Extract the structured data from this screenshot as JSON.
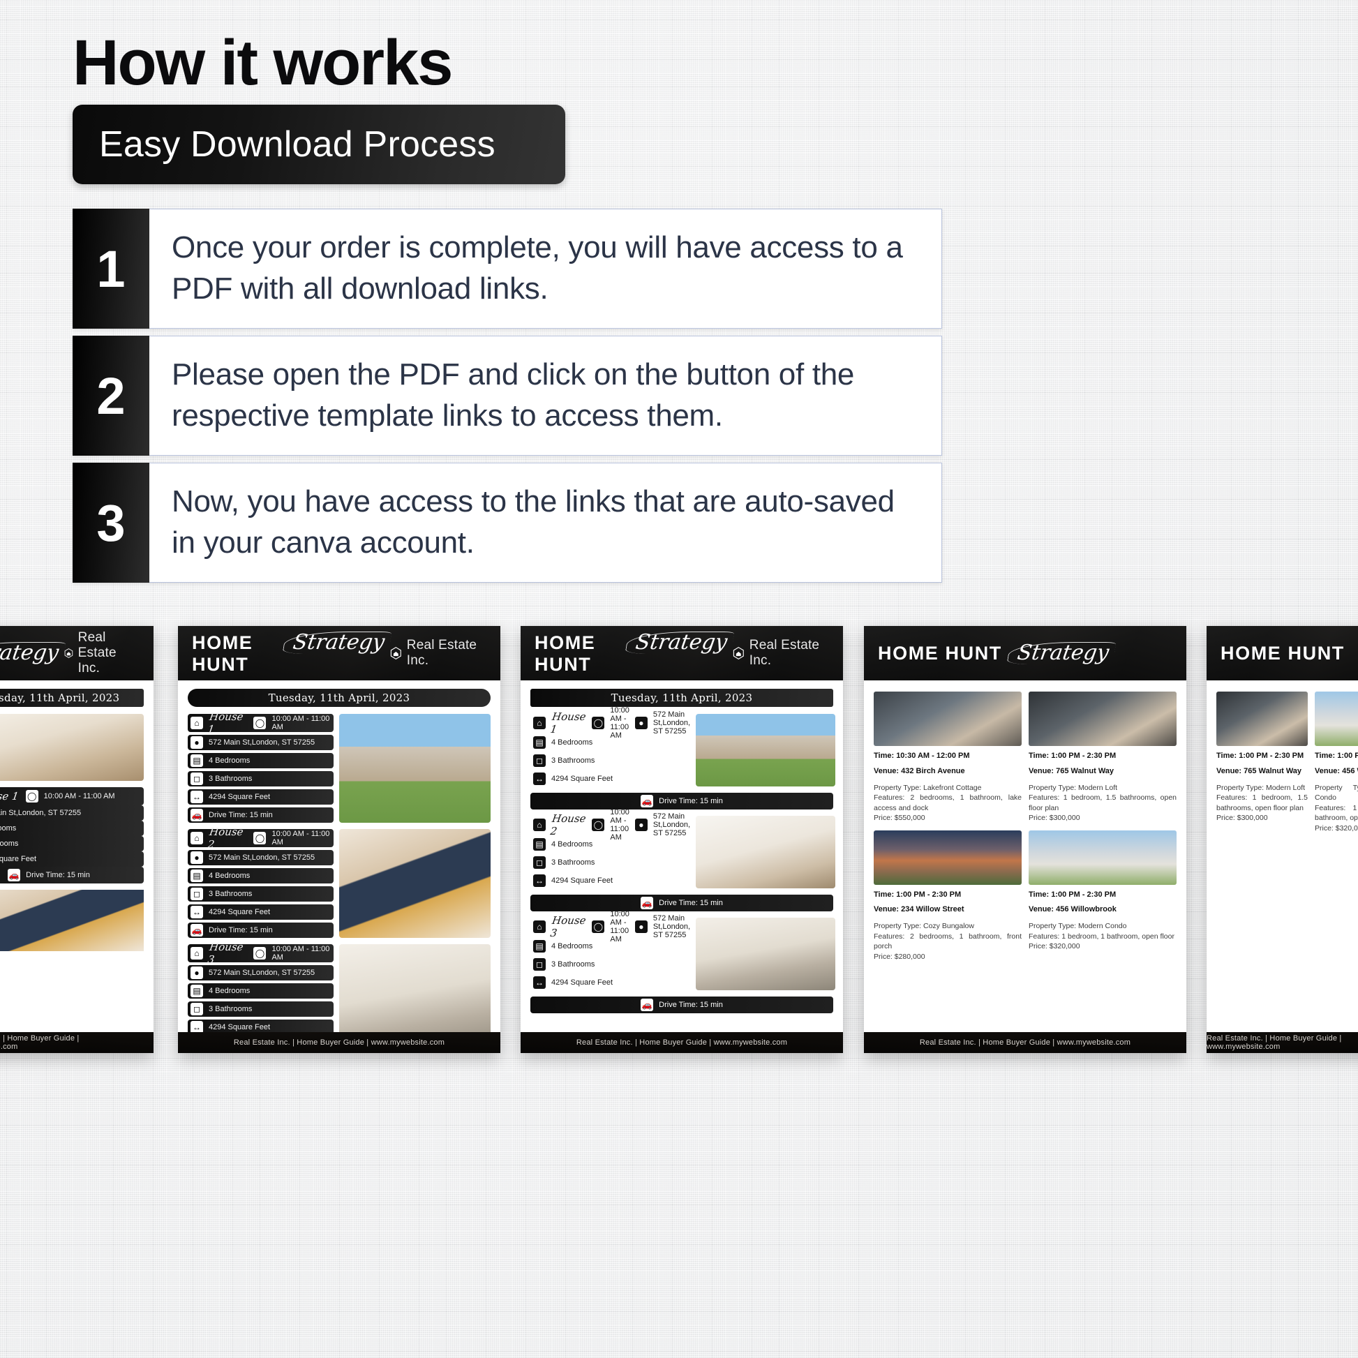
{
  "header": {
    "title": "How it works",
    "subtitle": "Easy Download Process"
  },
  "steps": [
    {
      "num": "1",
      "text": "Once your order is complete, you will have access to a PDF with all download links."
    },
    {
      "num": "2",
      "text": "Please open the PDF and click on the button of the respective template links to access them."
    },
    {
      "num": "3",
      "text": "Now, you have access to the links that are auto-saved in your canva account."
    }
  ],
  "mockup": {
    "brand": {
      "word1": "HOME HUNT",
      "script": "Strategy",
      "company": "Real Estate Inc."
    },
    "date": "Tuesday, 11th April, 2023",
    "footer": "Real Estate Inc. | Home Buyer Guide | www.mywebsite.com",
    "labels": {
      "time": "10:00 AM - 11:00 AM",
      "address": "572 Main St,London, ST 57255",
      "bedrooms": "4 Bedrooms",
      "bathrooms": "3 Bathrooms",
      "sqft": "4294 Square Feet",
      "drive": "Drive Time: 15 min"
    },
    "houses": [
      {
        "name": "House 1"
      },
      {
        "name": "House 2"
      },
      {
        "name": "House 3"
      }
    ],
    "open_houses": [
      {
        "time": "Time: 10:30 AM - 12:00 PM",
        "venue": "Venue: 432 Birch Avenue",
        "details": "Property Type: Lakefront Cottage\nFeatures: 2 bedrooms, 1 bathroom, lake access and dock\nPrice: $550,000"
      },
      {
        "time": "Time: 1:00 PM - 2:30 PM",
        "venue": "Venue: 765 Walnut Way",
        "details": "Property Type: Modern Loft\nFeatures: 1 bedroom, 1.5 bathrooms, open floor plan\nPrice: $300,000"
      },
      {
        "time": "Time: 1:00 PM - 2:30 PM",
        "venue": "Venue: 234 Willow Street",
        "details": "Property Type: Cozy Bungalow\nFeatures: 2 bedrooms, 1 bathroom, front porch\nPrice: $280,000"
      },
      {
        "time": "Time: 1:00 PM - 2:30 PM",
        "venue": "Venue: 456 Willowbrook",
        "details": "Property Type: Modern Condo\nFeatures: 1 bedroom, 1 bathroom, open floor\nPrice: $320,000"
      }
    ],
    "icons": {
      "house": "house-icon",
      "clock": "clock-icon",
      "pin": "map-pin-icon",
      "bed": "bed-icon",
      "bath": "bathtub-icon",
      "measure": "arrows-horizontal-icon",
      "car": "car-icon",
      "logo": "hexagon-house-icon"
    }
  },
  "colors": {
    "accent_dark": "#0a0a0a",
    "text_slate": "#2b3447",
    "border_blue": "#b9c3dd",
    "background": "#e9eaec"
  }
}
